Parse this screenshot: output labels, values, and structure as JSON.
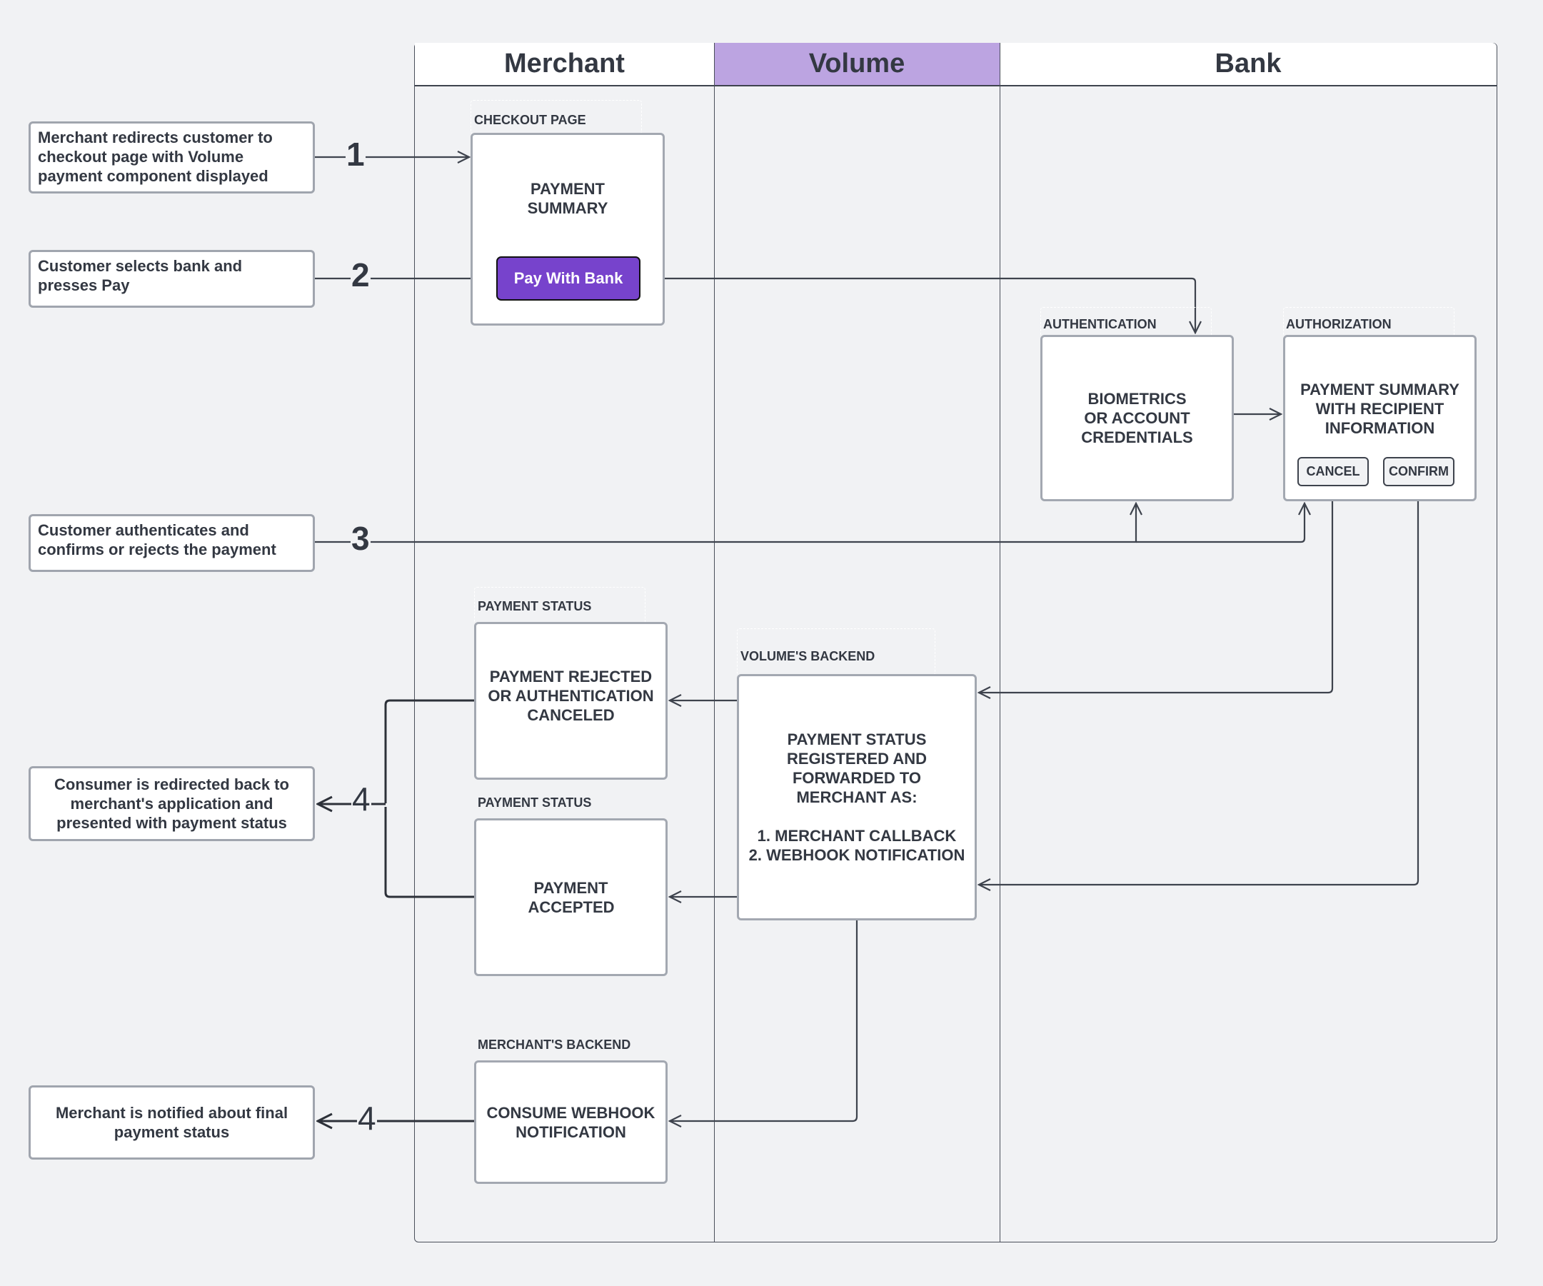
{
  "colors": {
    "background": "#f1f2f4",
    "volume_header": "#bca4e1",
    "pay_button": "#7743cc",
    "text": "#333842",
    "box_border": "#a3a8b1",
    "line": "#3e434d"
  },
  "lanes": [
    {
      "label": "Merchant"
    },
    {
      "label": "Volume"
    },
    {
      "label": "Bank"
    }
  ],
  "steps": [
    {
      "number": "1",
      "description": "Merchant redirects customer to checkout page with Volume payment component displayed"
    },
    {
      "number": "2",
      "description": "Customer selects bank and presses Pay"
    },
    {
      "number": "3",
      "description": "Customer authenticates and confirms or rejects the payment"
    },
    {
      "number": "4",
      "description": "Consumer is redirected back to merchant's application and presented with payment status"
    },
    {
      "number": "4",
      "description": "Merchant is notified about final payment status"
    }
  ],
  "groups": {
    "checkout": {
      "label": "CHECKOUT PAGE",
      "title": "PAYMENT SUMMARY",
      "button": "Pay With Bank"
    },
    "authentication": {
      "label": "AUTHENTICATION",
      "title": "BIOMETRICS OR ACCOUNT CREDENTIALS"
    },
    "authorization": {
      "label": "AUTHORIZATION",
      "title": "PAYMENT SUMMARY WITH RECIPIENT INFORMATION",
      "cancel": "CANCEL",
      "confirm": "CONFIRM"
    },
    "status_rejected": {
      "label": "PAYMENT STATUS",
      "title": "PAYMENT REJECTED OR AUTHENTICATION CANCELED"
    },
    "status_accepted": {
      "label": "PAYMENT STATUS",
      "title": "PAYMENT ACCEPTED"
    },
    "volume_backend": {
      "label": "VOLUME'S BACKEND",
      "line1": "PAYMENT STATUS REGISTERED AND FORWARDED TO MERCHANT AS:",
      "line2": "1. MERCHANT CALLBACK",
      "line3": "2. WEBHOOK NOTIFICATION"
    },
    "merchant_backend": {
      "label": "MERCHANT'S BACKEND",
      "title": "CONSUME WEBHOOK NOTIFICATION"
    }
  }
}
